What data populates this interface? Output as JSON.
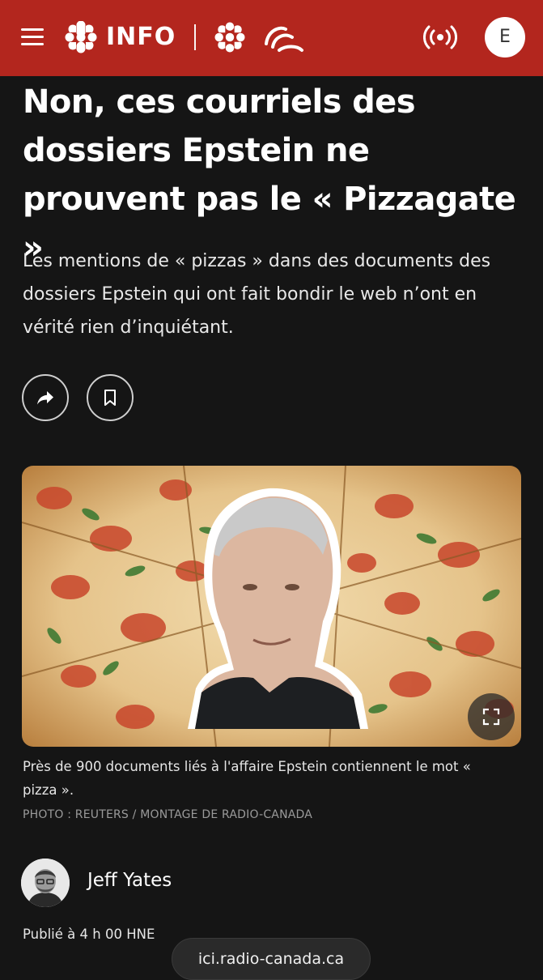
{
  "header": {
    "brand_label": "INFO",
    "avatar_initial": "E",
    "bar_color": "#b3261e",
    "icons": [
      "menu-icon",
      "cbc-gem-icon",
      "paralympic-logo-icon",
      "live-broadcast-icon"
    ]
  },
  "article": {
    "headline": "Non, ces courriels des dossiers Epstein ne prouvent pas le « Pizzagate »",
    "dek": "Les mentions de « pizzas » dans des documents des dossiers Epstein qui ont fait bondir le web n’ont en vérité rien d’inquiétant.",
    "actions": [
      "share-icon",
      "bookmark-icon"
    ],
    "image": {
      "caption": "Près de 900 documents liés à l'affaire Epstein contiennent le mot « pizza ».",
      "credit": "PHOTO : REUTERS / MONTAGE DE RADIO-CANADA"
    },
    "author": {
      "name": "Jeff Yates"
    },
    "published": "Publié à 4 h 00 HNE"
  },
  "browser": {
    "url": "ici.radio-canada.ca"
  }
}
